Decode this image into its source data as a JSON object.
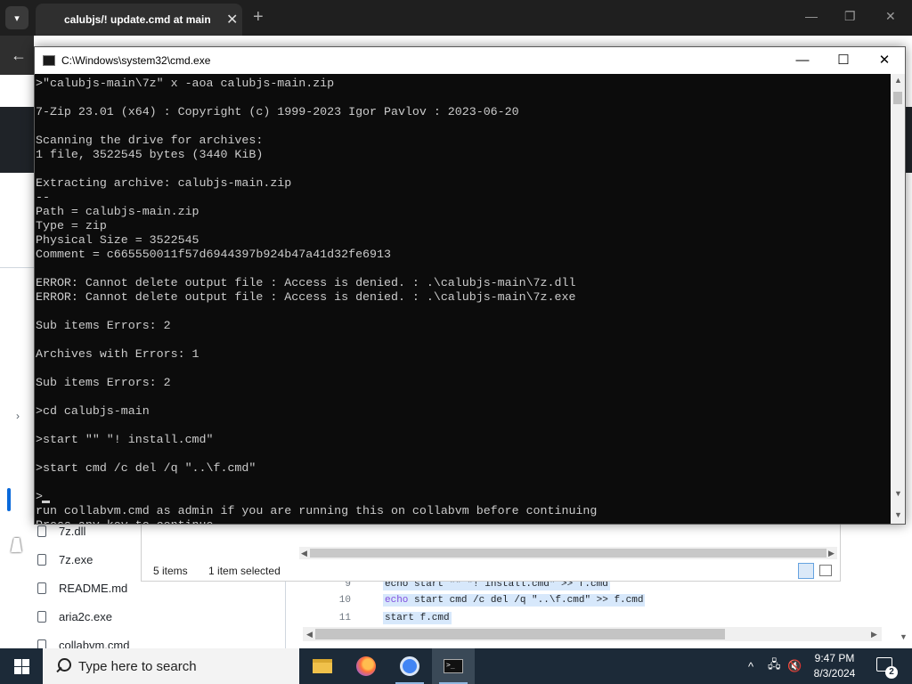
{
  "browser": {
    "tab_title": "calubjs/! update.cmd at main",
    "tab_close": "✕",
    "new_tab": "+",
    "minimize": "—",
    "restore": "❐",
    "close": "✕",
    "back": "←"
  },
  "cmd": {
    "title": "C:\\Windows\\system32\\cmd.exe",
    "minimize": "—",
    "maximize": "☐",
    "close": "✕",
    "lines": [
      ">\"calubjs-main\\7z\" x -aoa calubjs-main.zip",
      "",
      "7-Zip 23.01 (x64) : Copyright (c) 1999-2023 Igor Pavlov : 2023-06-20",
      "",
      "Scanning the drive for archives:",
      "1 file, 3522545 bytes (3440 KiB)",
      "",
      "Extracting archive: calubjs-main.zip",
      "--",
      "Path = calubjs-main.zip",
      "Type = zip",
      "Physical Size = 3522545",
      "Comment = c665550011f57d6944397b924b47a41d32fe6913",
      "",
      "ERROR: Cannot delete output file : Access is denied. : .\\calubjs-main\\7z.dll",
      "ERROR: Cannot delete output file : Access is denied. : .\\calubjs-main\\7z.exe",
      "",
      "Sub items Errors: 2",
      "",
      "Archives with Errors: 1",
      "",
      "Sub items Errors: 2",
      "",
      ">cd calubjs-main",
      "",
      ">start \"\" \"! install.cmd\"",
      "",
      ">start cmd /c del /q \"..\\f.cmd\"",
      "",
      ">",
      "run collabvm.cmd as admin if you are running this on collabvm before continuing",
      "Press any key to continue . . ."
    ]
  },
  "explorer": {
    "items_count": "5 items",
    "selected": "1 item selected"
  },
  "files": [
    "7z.dll",
    "7z.exe",
    "README.md",
    "aria2c.exe",
    "collabvm.cmd"
  ],
  "code": [
    {
      "num": "9",
      "text": "echo start \"\" \"! install.cmd\" >> f.cmd"
    },
    {
      "num": "10",
      "kw": "echo",
      "text": " start cmd /c del /q \"..\\f.cmd\" >> f.cmd"
    },
    {
      "num": "11",
      "text": "start f.cmd"
    }
  ],
  "taskbar": {
    "search_placeholder": "Type here to search",
    "time": "9:47 PM",
    "date": "8/3/2024",
    "notifications": "2",
    "tray_chevron": "^"
  }
}
